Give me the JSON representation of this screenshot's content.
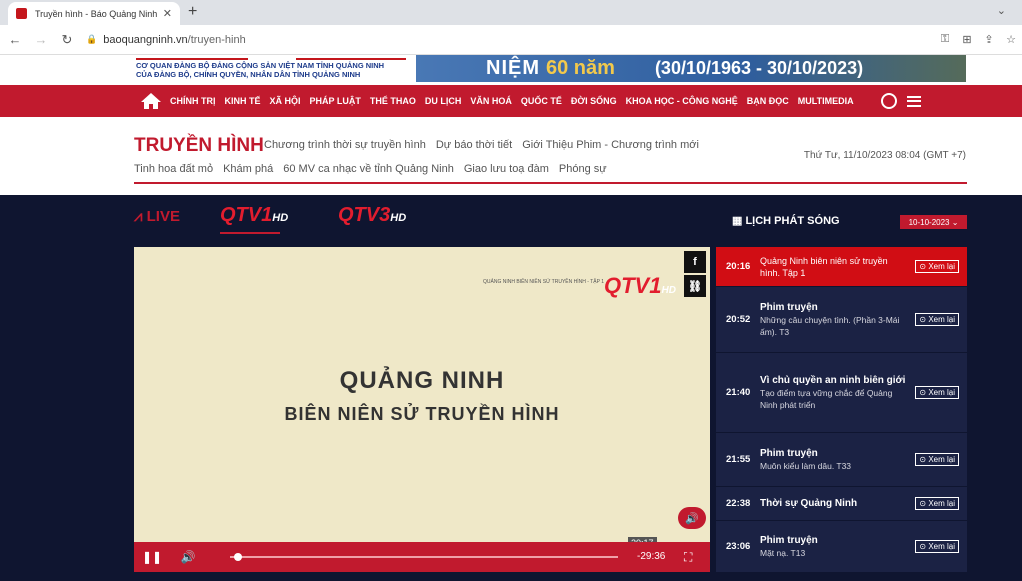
{
  "browser": {
    "tab_title": "Truyền hình - Báo Quảng Ninh",
    "url_host": "baoquangninh.vn",
    "url_path": "/truyen-hinh"
  },
  "banner": {
    "org_line1": "CƠ QUAN ĐẢNG BỘ ĐẢNG CỘNG SẢN VIỆT NAM TỈNH QUẢNG NINH",
    "org_line2": "CỦA ĐẢNG BỘ, CHÍNH QUYỀN, NHÂN DÂN TỈNH QUẢNG NINH",
    "anniv_word": "NIỆM",
    "anniv_num": "60 năm",
    "anniv_dates": "(30/10/1963 - 30/10/2023)"
  },
  "nav": {
    "items": [
      "CHÍNH TRỊ",
      "KINH TẾ",
      "XÃ HỘI",
      "PHÁP LUẬT",
      "THỂ THAO",
      "DU LỊCH",
      "VĂN HOÁ",
      "QUỐC TẾ",
      "ĐỜI SỐNG",
      "KHOA HỌC - CÔNG NGHỆ",
      "BẠN ĐỌC",
      "MULTIMEDIA"
    ]
  },
  "section": {
    "title": "TRUYỀN HÌNH",
    "links_row1": [
      "Chương trình thời sự truyền hình",
      "Dự báo thời tiết",
      "Giới Thiệu Phim - Chương trình mới"
    ],
    "links_row2": [
      "Tinh hoa đất mỏ",
      "Khám phá",
      "60 MV ca nhạc về tỉnh Quảng Ninh",
      "Giao lưu toạ đàm",
      "Phóng sự"
    ],
    "date": "Thứ Tư, 11/10/2023 08:04 (GMT +7)"
  },
  "tv": {
    "live_label": "LIVE",
    "channel1": "QTV1",
    "channel1_suffix": "HD",
    "channel3": "QTV3",
    "channel3_suffix": "HD",
    "schedule_title": "LỊCH PHÁT SÓNG",
    "schedule_date": "10-10-2023"
  },
  "player": {
    "title_line1": "QUẢNG NINH",
    "title_line2": "BIÊN NIÊN SỬ TRUYỀN HÌNH",
    "logo": "QTV1",
    "logo_suffix": "HD",
    "logo_caption": "QUẢNG NINH BIÊN NIÊN SỬ TRUYỀN HÌNH - TẬP 1",
    "current_time": "20:17",
    "remaining_time": "-29:36",
    "progress_fraction": 0.02
  },
  "schedule": {
    "replay_label": "Xem lại",
    "items": [
      {
        "time": "20:16",
        "program": "Quảng Ninh biên niên sử truyền hình. Tập 1",
        "desc": "",
        "active": true
      },
      {
        "time": "20:52",
        "program": "Phim truyện",
        "desc": "Những câu chuyện tình. (Phần 3-Mái ấm). T3",
        "active": false
      },
      {
        "time": "21:40",
        "program": "Vì chủ quyền an ninh biên giới",
        "desc": "Tạo điểm tựa vững chắc để Quảng Ninh phát triển",
        "active": false
      },
      {
        "time": "21:55",
        "program": "Phim truyện",
        "desc": "Muôn kiểu làm dâu. T33",
        "active": false
      },
      {
        "time": "22:38",
        "program": "Thời sự Quảng Ninh",
        "desc": "",
        "active": false
      },
      {
        "time": "23:06",
        "program": "Phim truyện",
        "desc": "Mặt nạ. T13",
        "active": false
      }
    ]
  }
}
